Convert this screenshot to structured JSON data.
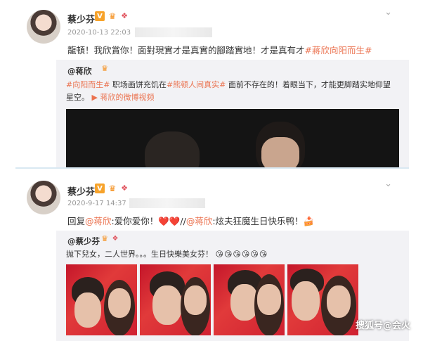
{
  "posts": [
    {
      "author": "蔡少芬",
      "badge_v": "V",
      "time": "2020-10-13 22:03",
      "text_parts": [
        "龍頓！我欣賞你！面對現實才是真實的腳踏實地！才是真有才",
        "#蔣欣向阳而生#"
      ],
      "repost": {
        "author": "@蒋欣",
        "line1_parts": [
          "#向阳而生#",
          " 职场画饼充饥在",
          "#熊顿人间真实#",
          " 面前不存在的！着眼当下，才能更脚踏实地仰望"
        ],
        "line2_parts": [
          "星空。",
          "▶ 蒋欣的微博视频"
        ],
        "media": "video"
      }
    },
    {
      "author": "蔡少芬",
      "badge_v": "V",
      "time": "2020-9-17 14:37",
      "text_parts": [
        "回复",
        "@蒋欣",
        ":爱你爱你！",
        "❤️❤️",
        "//",
        "@蒋欣",
        ":炫夫狂魔生日快乐鸭！",
        "🍰"
      ],
      "repost": {
        "author": "@蔡少芬",
        "line1": "抛下兒女，二人世界。。。生日快樂美女芬！",
        "line1_emoji": "😘😘😘😘😘😘",
        "photo_count": 4
      }
    }
  ],
  "watermark": "搜狐号@会火",
  "icons": {
    "verified": "verified-v-icon",
    "crown": "crown-icon",
    "tag": "tag-icon",
    "menu": "chevron-down-icon"
  },
  "colors": {
    "accent": "#eb7350",
    "badge": "#f7a32b",
    "repost_bg": "#f2f2f5"
  }
}
